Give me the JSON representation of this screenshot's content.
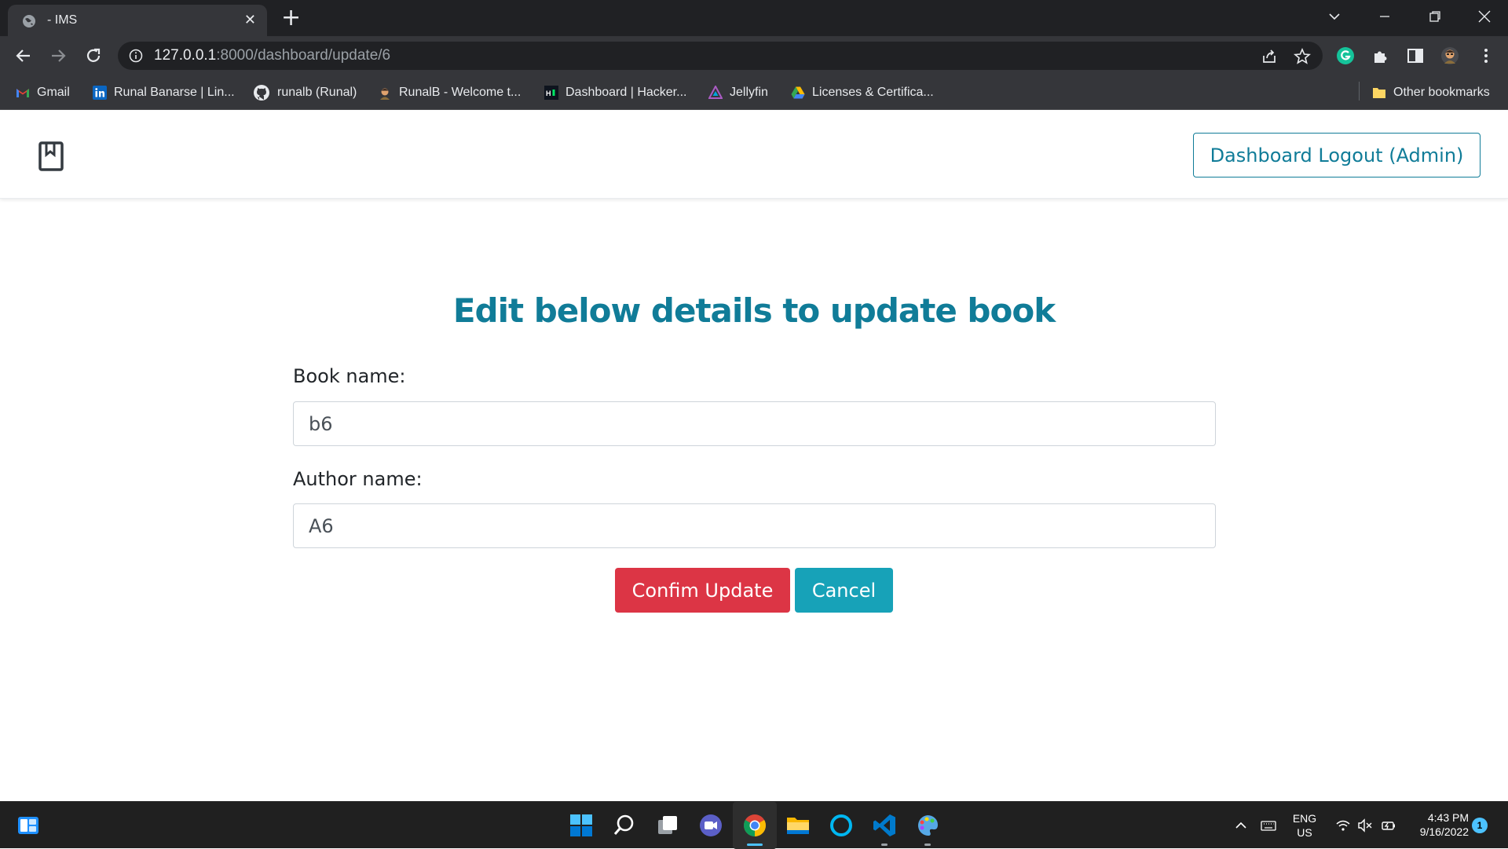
{
  "browser": {
    "tab_title": "- IMS",
    "close_tab": "✕",
    "new_tab": "+",
    "url_host": "127.0.0.1",
    "url_path": ":8000/dashboard/update/6"
  },
  "bookmarks": [
    {
      "label": "Gmail",
      "icon": "gmail-icon"
    },
    {
      "label": "Runal Banarse | Lin...",
      "icon": "linkedin-icon"
    },
    {
      "label": "runalb (Runal)",
      "icon": "github-icon"
    },
    {
      "label": "RunalB - Welcome t...",
      "icon": "avatar-icon"
    },
    {
      "label": "Dashboard | Hacker...",
      "icon": "hackerrank-icon"
    },
    {
      "label": "Jellyfin",
      "icon": "jellyfin-icon"
    },
    {
      "label": "Licenses & Certifica...",
      "icon": "google-drive-icon"
    }
  ],
  "other_bookmarks": "Other bookmarks",
  "navbar": {
    "brand_icon": "book-icon",
    "logout_label": "Dashboard Logout (Admin)"
  },
  "form": {
    "heading": "Edit below details to update book",
    "book_label": "Book name:",
    "book_value": "b6",
    "author_label": "Author name:",
    "author_value": "A6",
    "confirm_label": "Confim Update",
    "cancel_label": "Cancel"
  },
  "taskbar": {
    "lang_top": "ENG",
    "lang_bottom": "US",
    "time": "4:43 PM",
    "date": "9/16/2022",
    "notification_count": "1"
  },
  "colors": {
    "primary_teal": "#107c98",
    "danger": "#dc3545",
    "info": "#17a2b8"
  }
}
